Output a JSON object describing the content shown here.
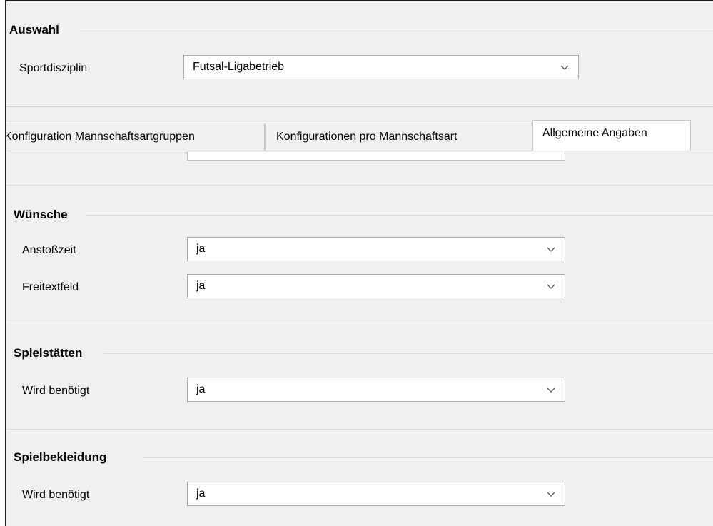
{
  "selection": {
    "title": "Auswahl",
    "sport_label": "Sportdisziplin",
    "sport_value": "Futsal-Ligabetrieb"
  },
  "tabs": [
    {
      "label": "Konfiguration Mannschaftsartgruppen"
    },
    {
      "label": "Konfigurationen pro Mannschaftsart"
    },
    {
      "label": "Allgemeine Angaben",
      "active": true
    }
  ],
  "wuensche": {
    "title": "Wünsche",
    "rows": [
      {
        "label": "Anstoßzeit",
        "value": "ja"
      },
      {
        "label": "Freitextfeld",
        "value": "ja"
      }
    ]
  },
  "spielstaetten": {
    "title": "Spielstätten",
    "rows": [
      {
        "label": "Wird benötigt",
        "value": "ja"
      }
    ]
  },
  "spielbekleidung": {
    "title": "Spielbekleidung",
    "rows": [
      {
        "label": "Wird benötigt",
        "value": "ja"
      }
    ]
  },
  "icons": {
    "dropdown": "chevron-down-icon"
  }
}
